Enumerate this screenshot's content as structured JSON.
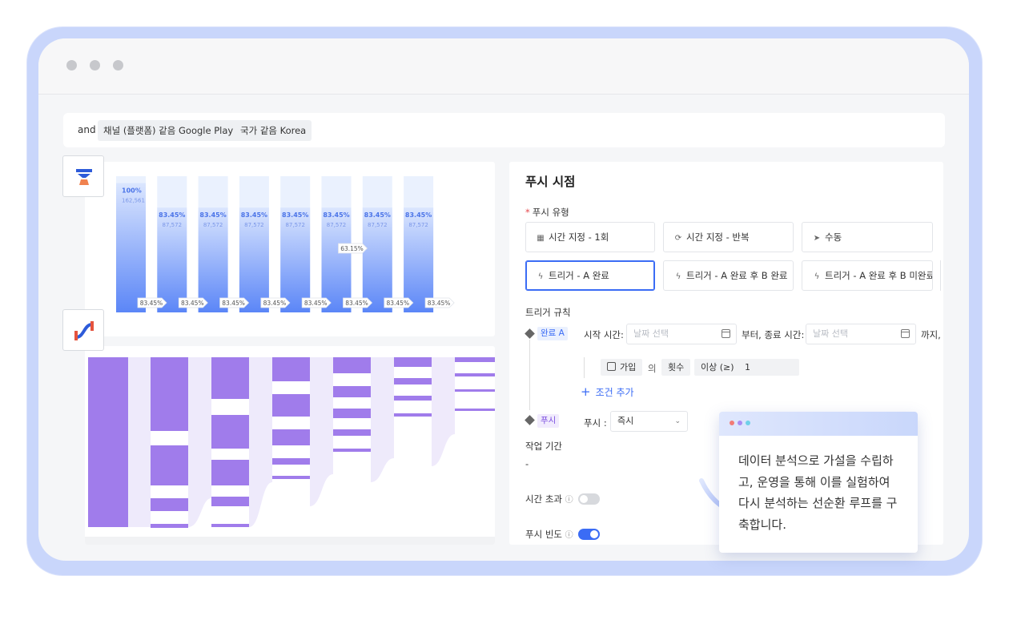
{
  "filters": {
    "and_label": "and",
    "chips": [
      "채널 (플랫폼) 같음 Google Play",
      "국가 같음 Korea"
    ]
  },
  "funnel": {
    "first_pct": "100%",
    "first_count": "162,561",
    "step_pct": "83.45%",
    "step_count": "87,572",
    "tooltip_pct": "63.15%",
    "bars": [
      {
        "pct": "100%",
        "count": "162,561",
        "level": 0.95
      },
      {
        "pct": "83.45%",
        "count": "87,572",
        "level": 0.77
      },
      {
        "pct": "83.45%",
        "count": "87,572",
        "level": 0.77
      },
      {
        "pct": "83.45%",
        "count": "87,572",
        "level": 0.77
      },
      {
        "pct": "83.45%",
        "count": "87,572",
        "level": 0.77
      },
      {
        "pct": "83.45%",
        "count": "87,572",
        "level": 0.77
      },
      {
        "pct": "83.45%",
        "count": "87,572",
        "level": 0.77
      },
      {
        "pct": "83.45%",
        "count": "87,572",
        "level": 0.77
      }
    ],
    "conversion_labels": [
      "83.45%",
      "83.45%",
      "83.45%",
      "83.45%",
      "83.45%",
      "83.45%",
      "83.45%",
      "83.45%"
    ]
  },
  "push": {
    "title": "푸시 시점",
    "type_label": "푸시 유형",
    "type_options": [
      {
        "label": "시간 지정 - 1회",
        "icon": "calendar-icon"
      },
      {
        "label": "시간 지정 - 반복",
        "icon": "repeat-icon"
      },
      {
        "label": "수동",
        "icon": "cursor-icon"
      },
      {
        "label": "트리거 - A 완료",
        "icon": "bolt-icon"
      },
      {
        "label": "트리거 - A 완료 후 B 완료",
        "icon": "bolt-icon"
      },
      {
        "label": "트리거 - A 완료 후 B 미완료",
        "icon": "bolt-icon"
      }
    ],
    "rule_label": "트리거 규칙",
    "complete_tag": "완료 A",
    "start_label": "시작 시간:",
    "start_placeholder": "날짜 선택",
    "end_label": "부터, 종료 시간:",
    "end_placeholder": "날짜 선택",
    "until_label": "까지,",
    "event_name": "가입",
    "of_label": "의",
    "count_label": "횟수",
    "op_label": "이상 (≥)",
    "count_value": "1",
    "add_condition": "조건 추가",
    "push_tag": "푸시",
    "push_label": "푸시 :",
    "push_value": "즉시",
    "period_label": "작업 기간",
    "period_value": "-",
    "timeout_label": "시간 초과",
    "frequency_label": "푸시 빈도",
    "timeout_on": false,
    "frequency_on": true,
    "accent": "#3b6cf5"
  },
  "popup": {
    "text": "데이터 분석으로 가설을 수립하고, 운영을 통해 이를 실험하여 다시 분석하는 선순환 루프를 구축합니다."
  }
}
